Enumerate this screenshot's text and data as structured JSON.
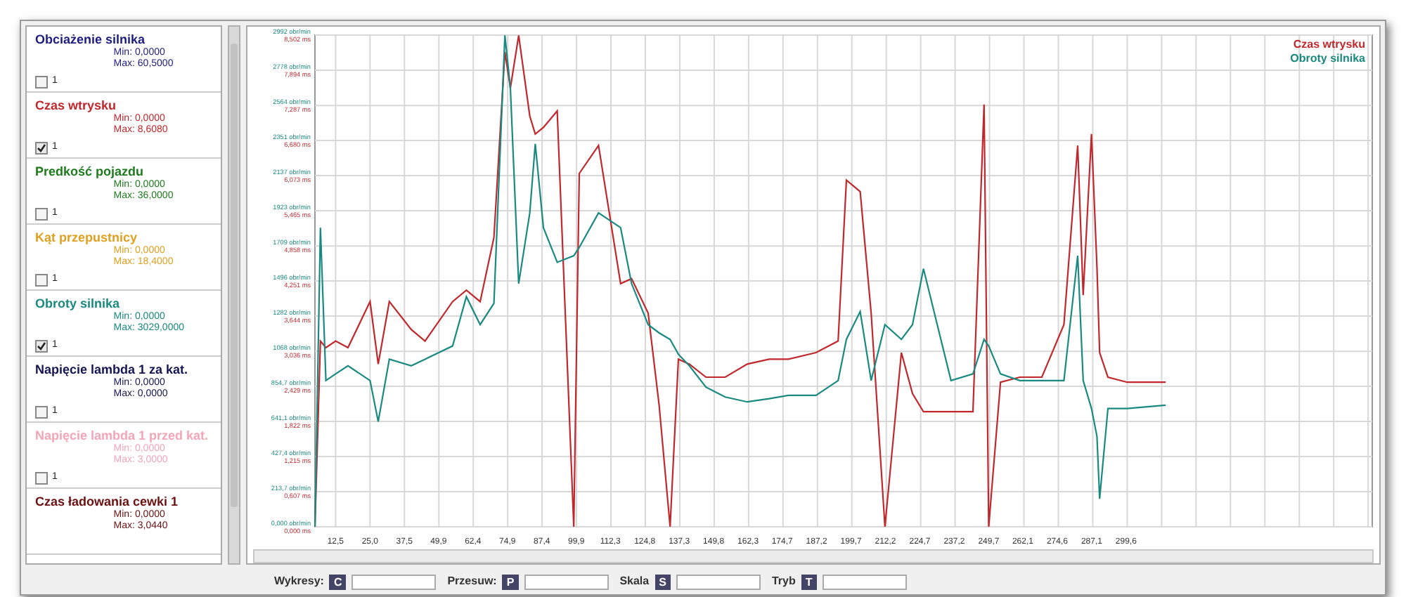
{
  "sidebar": {
    "items": [
      {
        "name": "Obciażenie silnika",
        "min": "Min: 0,0000",
        "max": "Max: 60,5000",
        "color": "#1c1c80",
        "checkbox_label": "1",
        "checked": false
      },
      {
        "name": "Czas wtrysku",
        "min": "Min: 0,0000",
        "max": "Max: 8,6080",
        "color": "#c0282d",
        "checkbox_label": "1",
        "checked": true
      },
      {
        "name": "Predkość pojazdu",
        "min": "Min: 0,0000",
        "max": "Max: 36,0000",
        "color": "#1e7a1e",
        "checkbox_label": "1",
        "checked": false
      },
      {
        "name": "Kąt przepustnicy",
        "min": "Min: 0,0000",
        "max": "Max: 18,4000",
        "color": "#e0a020",
        "checkbox_label": "1",
        "checked": false
      },
      {
        "name": "Obroty silnika",
        "min": "Min: 0,0000",
        "max": "Max: 3029,0000",
        "color": "#1a8a80",
        "checkbox_label": "1",
        "checked": true
      },
      {
        "name": "Napięcie lambda 1 za kat.",
        "min": "Min: 0,0000",
        "max": "Max: 0,0000",
        "color": "#141450",
        "checkbox_label": "1",
        "checked": false
      },
      {
        "name": "Napięcie lambda 1 przed kat.",
        "min": "Min: 0,0000",
        "max": "Max: 3,0000",
        "color": "#f2a6b6",
        "checkbox_label": "1",
        "checked": false
      },
      {
        "name": "Czas ładowania cewki 1",
        "min": "Min: 0,0000",
        "max": "Max: 3,0440",
        "color": "#6a1010"
      }
    ]
  },
  "chart": {
    "chart_data": {
      "type": "line",
      "x": [
        5,
        7,
        9,
        12.5,
        17,
        25,
        28,
        32,
        40,
        45,
        55,
        60,
        65,
        70,
        74,
        76,
        79,
        83,
        85,
        88,
        93,
        99,
        101,
        108,
        116,
        120,
        126,
        130,
        134,
        137,
        141,
        147,
        154,
        162,
        170,
        177,
        187,
        195,
        198,
        203,
        207,
        212,
        218,
        222,
        226,
        231,
        236,
        244,
        248,
        249.7,
        254,
        261,
        269,
        277,
        282,
        284,
        287,
        289,
        290,
        293,
        300,
        314
      ],
      "series": [
        {
          "name": "Czas wtrysku",
          "color": "#c0282d",
          "values": [
            0,
            1130,
            1090,
            1130,
            1090,
            1370,
            990,
            1370,
            1200,
            1130,
            1370,
            1440,
            1370,
            1760,
            2890,
            2670,
            2990,
            2500,
            2390,
            2430,
            2530,
            0,
            2150,
            2320,
            1480,
            1510,
            1300,
            740,
            0,
            1020,
            990,
            910,
            910,
            990,
            1020,
            1020,
            1060,
            1130,
            2110,
            2040,
            1300,
            0,
            1060,
            810,
            700,
            700,
            700,
            700,
            2570,
            0,
            880,
            910,
            910,
            1230,
            2320,
            1410,
            2390,
            1580,
            1060,
            910,
            880,
            880
          ]
        },
        {
          "name": "Obroty silnika",
          "color": "#1a8a80",
          "values": [
            0,
            1820,
            890,
            930,
            980,
            890,
            640,
            1020,
            980,
            1020,
            1100,
            1400,
            1230,
            1360,
            2990,
            2670,
            1480,
            1910,
            2330,
            1820,
            1610,
            1650,
            1700,
            1910,
            1820,
            1480,
            1230,
            1180,
            1140,
            1050,
            980,
            850,
            790,
            760,
            780,
            800,
            800,
            890,
            1140,
            1310,
            890,
            1230,
            1140,
            1230,
            1570,
            1230,
            890,
            930,
            1140,
            1100,
            930,
            890,
            890,
            890,
            1650,
            890,
            720,
            550,
            170,
            720,
            720,
            740
          ]
        }
      ],
      "xlim": [
        5,
        389
      ],
      "ylim": [
        0,
        2992
      ],
      "grid": true,
      "xticks": [
        {
          "value": 12.5,
          "label": "12,5"
        },
        {
          "value": 25,
          "label": "25,0"
        },
        {
          "value": 37.5,
          "label": "37,5"
        },
        {
          "value": 49.9,
          "label": "49,9"
        },
        {
          "value": 62.4,
          "label": "62,4"
        },
        {
          "value": 74.9,
          "label": "74,9"
        },
        {
          "value": 87.4,
          "label": "87,4"
        },
        {
          "value": 99.9,
          "label": "99,9"
        },
        {
          "value": 112.3,
          "label": "112,3"
        },
        {
          "value": 124.8,
          "label": "124,8"
        },
        {
          "value": 137.3,
          "label": "137,3"
        },
        {
          "value": 149.8,
          "label": "149,8"
        },
        {
          "value": 162.3,
          "label": "162,3"
        },
        {
          "value": 174.7,
          "label": "174,7"
        },
        {
          "value": 187.2,
          "label": "187,2"
        },
        {
          "value": 199.7,
          "label": "199,7"
        },
        {
          "value": 212.2,
          "label": "212,2"
        },
        {
          "value": 224.7,
          "label": "224,7"
        },
        {
          "value": 237.2,
          "label": "237,2"
        },
        {
          "value": 249.7,
          "label": "249,7"
        },
        {
          "value": 262.1,
          "label": "262,1"
        },
        {
          "value": 274.6,
          "label": "274,6"
        },
        {
          "value": 287.1,
          "label": "287,1"
        },
        {
          "value": 299.6,
          "label": "299,6"
        }
      ],
      "yticks": [
        {
          "value": 0,
          "label": "0,000 obr/min"
        },
        {
          "value": 213.7,
          "label": "213,7 obr/min"
        },
        {
          "value": 427.4,
          "label": "427,4 obr/min"
        },
        {
          "value": 641.1,
          "label": "641,1 obr/min"
        },
        {
          "value": 854.7,
          "label": "854,7 obr/min"
        },
        {
          "value": 1068,
          "label": "1068 obr/min"
        },
        {
          "value": 1282,
          "label": "1282 obr/min"
        },
        {
          "value": 1496,
          "label": "1496 obr/min"
        },
        {
          "value": 1709,
          "label": "1709 obr/min"
        },
        {
          "value": 1923,
          "label": "1923 obr/min"
        },
        {
          "value": 2137,
          "label": "2137 obr/min"
        },
        {
          "value": 2351,
          "label": "2351 obr/min"
        },
        {
          "value": 2564,
          "label": "2564 obr/min"
        },
        {
          "value": 2778,
          "label": "2778 obr/min"
        },
        {
          "value": 2992,
          "label": "2992 obr/min"
        }
      ],
      "annotations": [
        "0,000 ms",
        "0,607 ms",
        "1,215 ms",
        "1,822 ms",
        "2,429 ms",
        "3,036 ms",
        "3,644 ms",
        "4,251 ms",
        "4,858 ms",
        "5,465 ms",
        "6,073 ms",
        "6,680 ms",
        "7,287 ms",
        "7,894 ms",
        "8,502 ms"
      ]
    }
  },
  "toolbar": [
    {
      "label": "Wykresy:",
      "key": "C"
    },
    {
      "label": "Przesuw:",
      "key": "P"
    },
    {
      "label": "Skala",
      "key": "S"
    },
    {
      "label": "Tryb",
      "key": "T"
    }
  ]
}
